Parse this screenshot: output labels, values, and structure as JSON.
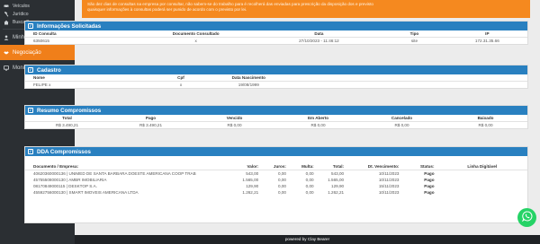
{
  "sidebar": {
    "items": [
      {
        "label": "Veículos",
        "icon": "car-icon"
      },
      {
        "label": "Jurídico",
        "icon": "gavel-icon"
      },
      {
        "label": "Busca Bens",
        "icon": "home-icon"
      },
      {
        "label": "Minha Conta",
        "icon": "user-icon"
      },
      {
        "label": "Negociação",
        "icon": "handshake-icon"
      },
      {
        "label": "Monitor Análise",
        "icon": "monitor-icon"
      }
    ]
  },
  "alert": {
    "line1": "São dez dias de consultas na empresa por consultar, não sabem-se do trabalho para é recolherá das enviadas para prescrição da disposição dos e previsto",
    "line2": "quaisquer informações à consultas poderá ser punido de acordo com o previsto por lei."
  },
  "info": {
    "title": "Informações Solicitadas",
    "headers": [
      "ID Consulta",
      "Documento Consultado",
      "Data",
      "Tipo",
      "IP"
    ],
    "row": [
      "6350615",
      "x",
      "27/10/2023 - 11:46:12",
      "site",
      "172.31.35.66"
    ]
  },
  "cadastro": {
    "title": "Cadastro",
    "headers": [
      "Nome",
      "Cpf",
      "Data Nascimento"
    ],
    "row": [
      "FELIPE x",
      "x",
      "19/08/1999"
    ]
  },
  "resumo": {
    "title": "Resumo Compromissos",
    "headers": [
      "Total",
      "Pago",
      "Vencido",
      "Em Aberto",
      "Cancelado",
      "Baixado"
    ],
    "row": [
      "R$ 3.490,21",
      "R$ 3.490,21",
      "R$ 0,00",
      "R$ 0,00",
      "R$ 0,00",
      "R$ 0,00"
    ]
  },
  "dda": {
    "title": "DDA Compromissos",
    "headers": [
      "Documento / Empresa:",
      "Valor:",
      "Juros:",
      "Multa:",
      "Total:",
      "Dt. Vencimento:",
      "Status:",
      "Linha Digitável"
    ],
    "rows": [
      [
        "40620360000136 | UNIMED DE SANTA BARBARA DOESTE AMERICANA COOP TRAB",
        "543,00",
        "0,00",
        "0,00",
        "543,00",
        "10/11/2023",
        "Pago",
        ""
      ],
      [
        "45755508000130 | AMBR IMOBILIARIA",
        "1.565,00",
        "0,00",
        "0,00",
        "1.565,00",
        "10/11/2023",
        "Pago",
        ""
      ],
      [
        "08170849000115 | DESKTOP S.A.",
        "129,90",
        "0,00",
        "0,00",
        "129,90",
        "15/11/2023",
        "Pago",
        ""
      ],
      [
        "45592756000130 | SMART IMOVEIS AMERICANA LTDA",
        "1.262,21",
        "0,00",
        "0,00",
        "1.262,21",
        "10/11/2023",
        "Pago",
        ""
      ]
    ]
  },
  "footer": {
    "text": "powered by Clay Bearer"
  },
  "colors": {
    "accent": "#f07f1a",
    "header": "#2980c0",
    "whatsapp": "#25d366"
  }
}
